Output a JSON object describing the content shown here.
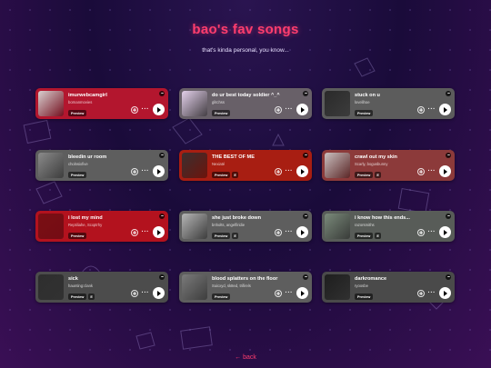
{
  "header": {
    "title": "bao's fav songs",
    "subtitle": "that's kinda personal, you know..."
  },
  "common": {
    "preview_label": "Preview",
    "explicit_label": "E"
  },
  "songs": [
    {
      "title": "imurwebcamgirl",
      "artist": "bornanmovies",
      "bg": "#b3162e",
      "art": "#d8d0d0",
      "explicit": false
    },
    {
      "title": "do ur best today soldier ^_^",
      "artist": "glitchss",
      "bg": "#686068",
      "art": "#e3d0ea",
      "explicit": false
    },
    {
      "title": "stuck on u",
      "artist": "lovelihoe",
      "bg": "#5c5c5c",
      "art": "#2a2a2a",
      "explicit": false
    },
    {
      "title": "bleedin ur room",
      "artist": "cholnsixfive",
      "bg": "#5e5e5e",
      "art": "#8a8a8a",
      "explicit": false
    },
    {
      "title": "THE BEST OF ME",
      "artist": "Nexiaté",
      "bg": "#a81e12",
      "art": "#3a3030",
      "explicit": true
    },
    {
      "title": "crawl out my skin",
      "artist": "Scarly, bogusbunny",
      "bg": "#8c3a3a",
      "art": "#c9c0c0",
      "explicit": true
    },
    {
      "title": "i lost my mind",
      "artist": "Reptiliahe, Scxptrhy",
      "bg": "#b3121e",
      "art": "#7a0f14",
      "explicit": false
    },
    {
      "title": "she just broke down",
      "artist": "bnholts, angelfiridie",
      "bg": "#5e5e5e",
      "art": "#b5b5b5",
      "explicit": true
    },
    {
      "title": "i know how this ends...",
      "artist": "razorsmiths",
      "bg": "#585c58",
      "art": "#7a8a7a",
      "explicit": true
    },
    {
      "title": "sick",
      "artist": "haunting:clank",
      "bg": "#4c4c4c",
      "art": "#2e2e2e",
      "explicit": true
    },
    {
      "title": "blood splatters on the floor",
      "artist": "Suicxyd, sk8ed, trifirels",
      "bg": "#5e5e5e",
      "art": "#7a7a7a",
      "explicit": false
    },
    {
      "title": "darkromance",
      "artist": "ryoosbe",
      "bg": "#4a4a4a",
      "art": "#1e1e1e",
      "explicit": false
    }
  ],
  "footer": {
    "back_label": "← back"
  }
}
